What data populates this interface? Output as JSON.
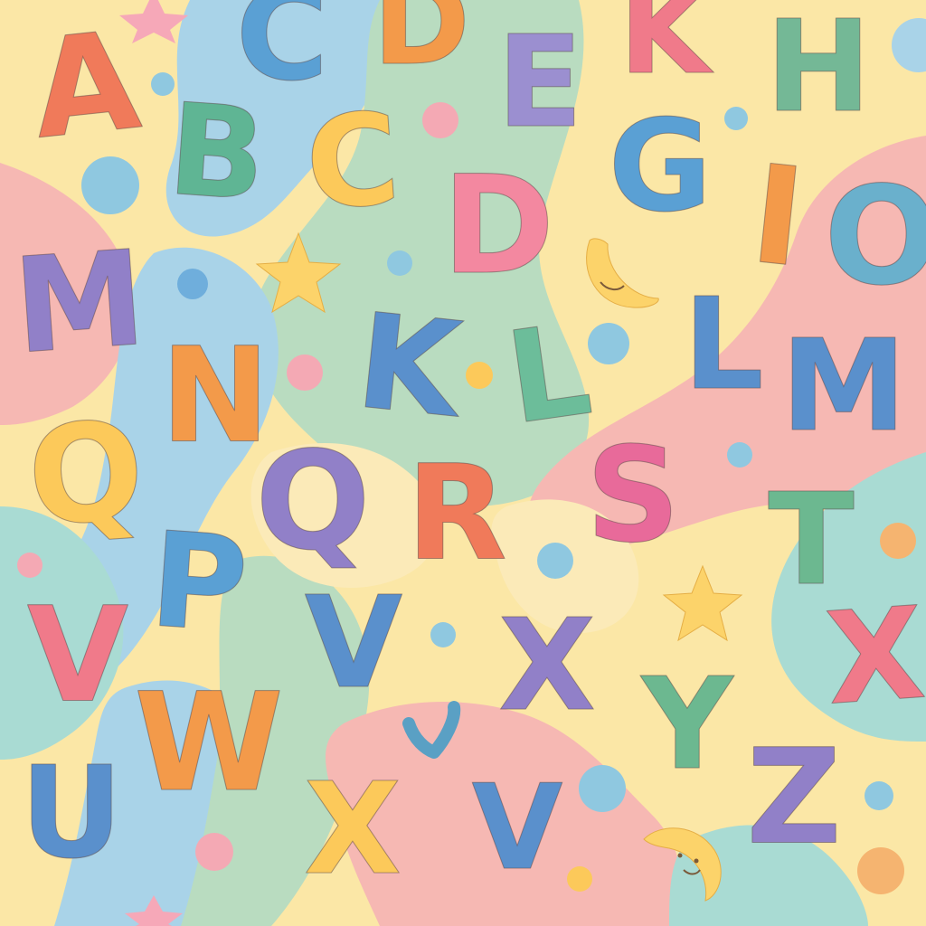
{
  "palette": {
    "background": "#fbe7a6",
    "blob_yellow": "#fde58f",
    "blob_blue": "#a9d3e8",
    "blob_green": "#b9dcc0",
    "blob_pink": "#f6b8b3",
    "blob_teal": "#a9dbd3",
    "dot_pink": "#f4a9b4",
    "dot_blue": "#8fc8e0",
    "dot_orange": "#f5b470",
    "star": "#fcd36a",
    "moon": "#fcd36a"
  },
  "letters": [
    {
      "char": "A",
      "color": "#f07a5a"
    },
    {
      "char": "C",
      "color": "#5aa0d4"
    },
    {
      "char": "D",
      "color": "#f39a4a"
    },
    {
      "char": "E",
      "color": "#9b8fd0"
    },
    {
      "char": "K",
      "color": "#f07a8a"
    },
    {
      "char": "H",
      "color": "#74b896"
    },
    {
      "char": "B",
      "color": "#5fb594"
    },
    {
      "char": "C",
      "color": "#fcc95a"
    },
    {
      "char": "D",
      "color": "#f388a0"
    },
    {
      "char": "G",
      "color": "#5aa0d4"
    },
    {
      "char": "I",
      "color": "#f39a4a"
    },
    {
      "char": "O",
      "color": "#6ab0cc"
    },
    {
      "char": "M",
      "color": "#9180c8"
    },
    {
      "char": "N",
      "color": "#f39a4a"
    },
    {
      "char": "K",
      "color": "#5a90cc"
    },
    {
      "char": "L",
      "color": "#6cbd9a"
    },
    {
      "char": "L",
      "color": "#5a90cc"
    },
    {
      "char": "M",
      "color": "#5a90cc"
    },
    {
      "char": "Q",
      "color": "#fcc95a"
    },
    {
      "char": "Q",
      "color": "#9180c8"
    },
    {
      "char": "R",
      "color": "#f07a5a"
    },
    {
      "char": "S",
      "color": "#e86a9a"
    },
    {
      "char": "T",
      "color": "#6cb890"
    },
    {
      "char": "P",
      "color": "#5aa0d4"
    },
    {
      "char": "V",
      "color": "#f07a8a"
    },
    {
      "char": "V",
      "color": "#5a90cc"
    },
    {
      "char": "X",
      "color": "#9180c8"
    },
    {
      "char": "X",
      "color": "#f07a8a"
    },
    {
      "char": "Y",
      "color": "#6cb890"
    },
    {
      "char": "W",
      "color": "#f39a4a"
    },
    {
      "char": "U",
      "color": "#5a90cc"
    },
    {
      "char": "X",
      "color": "#fcc95a"
    },
    {
      "char": "V",
      "color": "#5a90cc"
    },
    {
      "char": "Z",
      "color": "#9180c8"
    }
  ],
  "decorations": [
    {
      "type": "star",
      "icon": "star-icon"
    },
    {
      "type": "star",
      "icon": "star-icon"
    },
    {
      "type": "star",
      "icon": "star-icon"
    },
    {
      "type": "moon",
      "icon": "moon-icon"
    },
    {
      "type": "moon",
      "icon": "moon-icon"
    },
    {
      "type": "heart",
      "icon": "heart-icon"
    }
  ]
}
